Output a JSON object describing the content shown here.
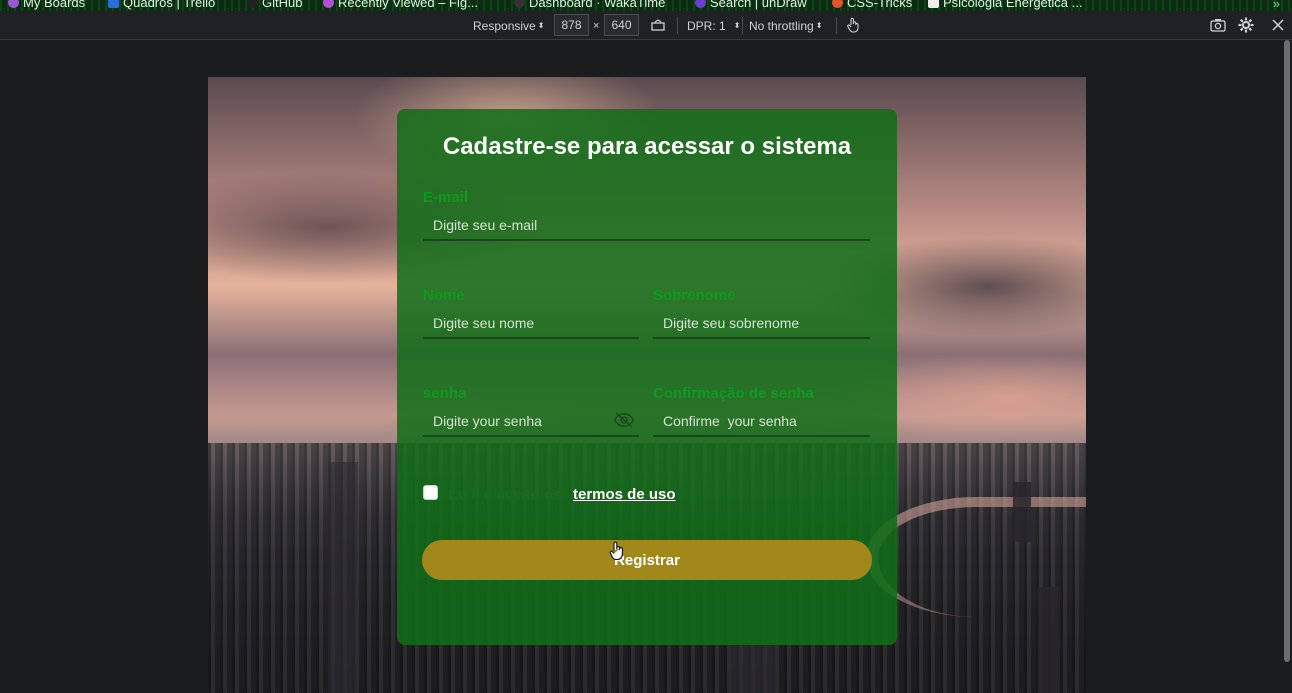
{
  "bookmarks": [
    {
      "label": "My Boards",
      "color": "#9b59d0"
    },
    {
      "label": "Quadros | Trello",
      "color": "#2a6fd6"
    },
    {
      "label": "GitHub",
      "color": "#222222"
    },
    {
      "label": "Recently Viewed – Fig...",
      "color": "#b24fd6"
    },
    {
      "label": "Dashboard · WakaTime",
      "color": "#333333"
    },
    {
      "label": "Search | unDraw",
      "color": "#6c3fd1"
    },
    {
      "label": "CSS-Tricks",
      "color": "#e2542a"
    },
    {
      "label": "Psicologia Energética ...",
      "color": "#eeeeee"
    }
  ],
  "devtools": {
    "device_mode": "Responsive",
    "width": "878",
    "times": "×",
    "height": "640",
    "dpr": "DPR: 1",
    "throttling": "No throttling",
    "icons": [
      "rotate-icon",
      "touch-icon",
      "screenshot-icon",
      "settings-icon",
      "close-icon"
    ]
  },
  "form": {
    "title": "Cadastre-se para acessar o sistema",
    "email": {
      "label": "E-mail",
      "placeholder": "Digite seu e-mail"
    },
    "nome": {
      "label": "Nome",
      "placeholder": "Digite seu nome"
    },
    "sobrenome": {
      "label": "Sobrenome",
      "placeholder": "Digite seu sobrenome"
    },
    "senha": {
      "label": "senha",
      "placeholder": "Digite your senha"
    },
    "confirmacao": {
      "label": "Confirmação de senha",
      "placeholder": "Confirme  your senha"
    },
    "terms_text": "Eu li e aceito os",
    "terms_link": "termos de uso",
    "submit": "Registrar"
  },
  "colors": {
    "card": "#126e18",
    "label_green": "#0e9a1f",
    "button": "#a2871a"
  }
}
